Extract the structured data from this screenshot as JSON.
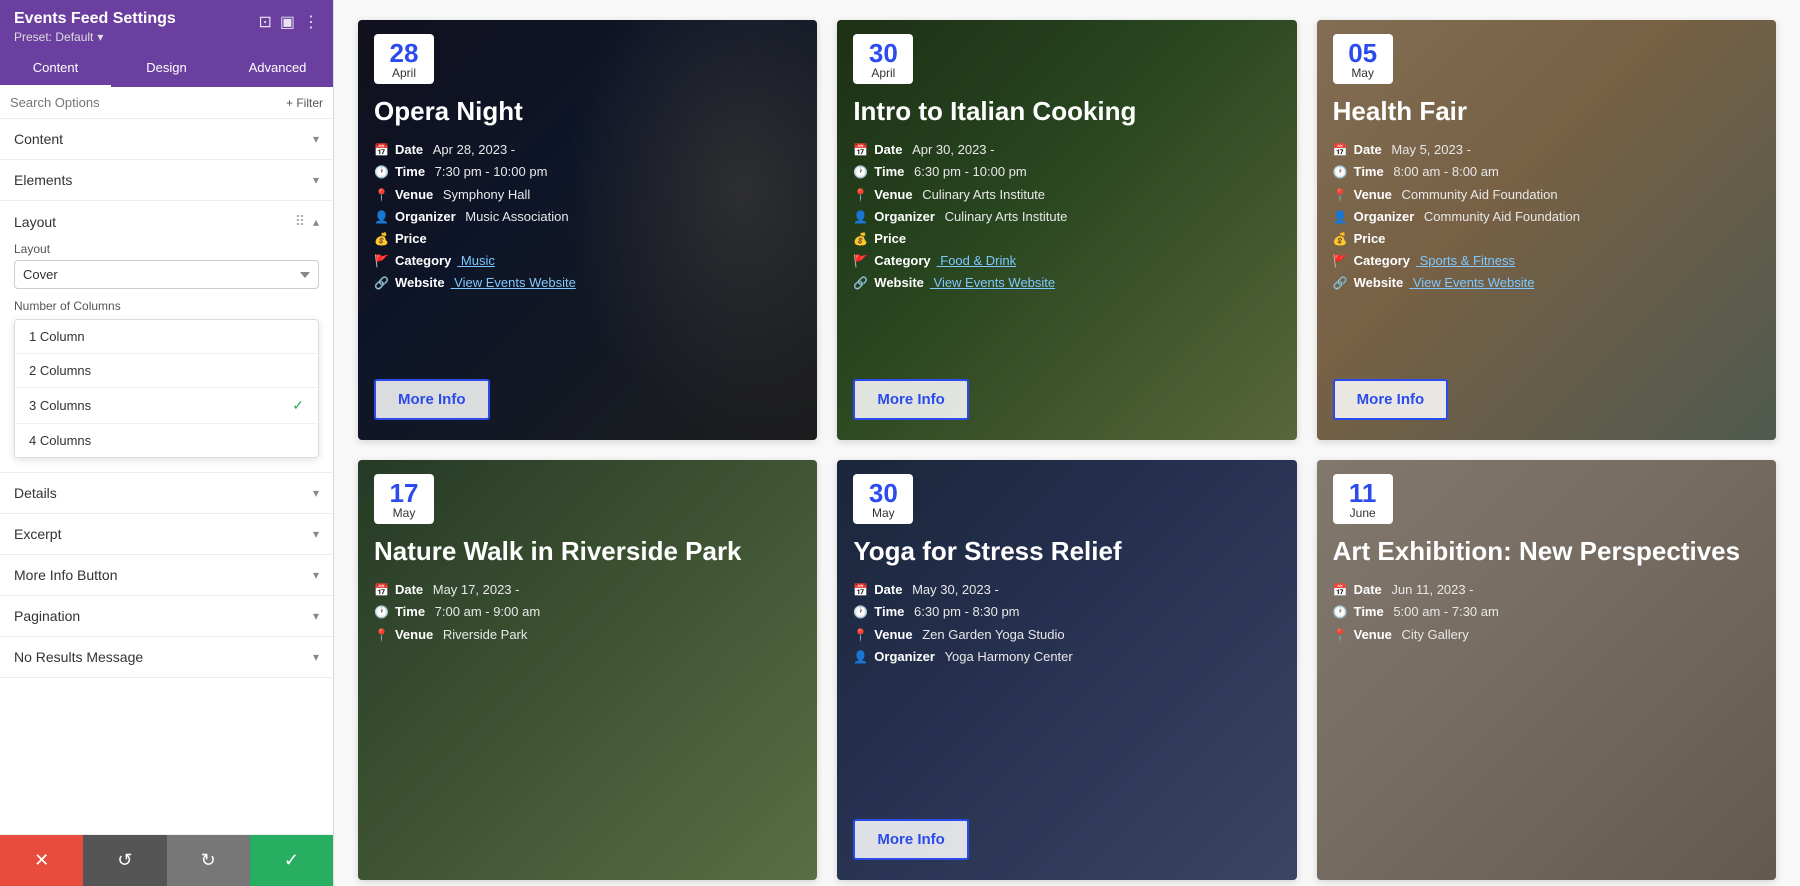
{
  "app": {
    "title": "Events Feed Settings",
    "preset": "Preset: Default"
  },
  "sidebar": {
    "tabs": [
      {
        "id": "content",
        "label": "Content"
      },
      {
        "id": "design",
        "label": "Design"
      },
      {
        "id": "advanced",
        "label": "Advanced"
      }
    ],
    "active_tab": "content",
    "search_placeholder": "Search Options",
    "filter_label": "+ Filter",
    "sections": [
      {
        "id": "content",
        "label": "Content",
        "expanded": false
      },
      {
        "id": "elements",
        "label": "Elements",
        "expanded": false
      },
      {
        "id": "layout",
        "label": "Layout",
        "expanded": true
      },
      {
        "id": "details",
        "label": "Details",
        "expanded": false
      },
      {
        "id": "excerpt",
        "label": "Excerpt",
        "expanded": false
      },
      {
        "id": "more-info-button",
        "label": "More Info Button",
        "expanded": false
      },
      {
        "id": "pagination",
        "label": "Pagination",
        "expanded": false
      },
      {
        "id": "no-results-message",
        "label": "No Results Message",
        "expanded": false
      }
    ],
    "layout": {
      "label": "Layout",
      "value": "Cover",
      "columns_label": "Number of Columns",
      "options": [
        {
          "id": "1col",
          "label": "1 Column",
          "selected": false
        },
        {
          "id": "2col",
          "label": "2 Columns",
          "selected": false
        },
        {
          "id": "3col",
          "label": "3 Columns",
          "selected": true
        },
        {
          "id": "4col",
          "label": "4 Columns",
          "selected": false
        }
      ]
    },
    "bottom_bar": {
      "cancel_icon": "✕",
      "reset_icon": "↺",
      "redo_icon": "↻",
      "save_icon": "✓"
    }
  },
  "events": [
    {
      "id": "opera-night",
      "date_day": "28",
      "date_month": "April",
      "title": "Opera Night",
      "details": [
        {
          "icon": "📅",
          "label": "Date",
          "value": "Apr 28, 2023 -",
          "type": "text"
        },
        {
          "icon": "🕐",
          "label": "Time",
          "value": "7:30 pm - 10:00 pm",
          "type": "text"
        },
        {
          "icon": "📍",
          "label": "Venue",
          "value": "Symphony Hall",
          "type": "text"
        },
        {
          "icon": "👤",
          "label": "Organizer",
          "value": "Music Association",
          "type": "text"
        },
        {
          "icon": "💰",
          "label": "Price",
          "value": "",
          "type": "text"
        },
        {
          "icon": "🚩",
          "label": "Category",
          "value": "Music",
          "type": "link"
        },
        {
          "icon": "🔗",
          "label": "Website",
          "value": "View Events Website",
          "type": "link"
        }
      ],
      "more_info": "More Info",
      "card_class": "card-opera"
    },
    {
      "id": "italian-cooking",
      "date_day": "30",
      "date_month": "April",
      "title": "Intro to Italian Cooking",
      "details": [
        {
          "icon": "📅",
          "label": "Date",
          "value": "Apr 30, 2023 -",
          "type": "text"
        },
        {
          "icon": "🕐",
          "label": "Time",
          "value": "6:30 pm - 10:00 pm",
          "type": "text"
        },
        {
          "icon": "📍",
          "label": "Venue",
          "value": "Culinary Arts Institute",
          "type": "text"
        },
        {
          "icon": "👤",
          "label": "Organizer",
          "value": "Culinary Arts Institute",
          "type": "text"
        },
        {
          "icon": "💰",
          "label": "Price",
          "value": "",
          "type": "text"
        },
        {
          "icon": "🚩",
          "label": "Category",
          "value": "Food & Drink",
          "type": "link"
        },
        {
          "icon": "🔗",
          "label": "Website",
          "value": "View Events Website",
          "type": "link"
        }
      ],
      "more_info": "More Info",
      "card_class": "card-italian"
    },
    {
      "id": "health-fair",
      "date_day": "05",
      "date_month": "May",
      "title": "Health Fair",
      "details": [
        {
          "icon": "📅",
          "label": "Date",
          "value": "May 5, 2023 -",
          "type": "text"
        },
        {
          "icon": "🕐",
          "label": "Time",
          "value": "8:00 am - 8:00 am",
          "type": "text"
        },
        {
          "icon": "📍",
          "label": "Venue",
          "value": "Community Aid Foundation",
          "type": "text"
        },
        {
          "icon": "👤",
          "label": "Organizer",
          "value": "Community Aid Foundation",
          "type": "text"
        },
        {
          "icon": "💰",
          "label": "Price",
          "value": "",
          "type": "text"
        },
        {
          "icon": "🚩",
          "label": "Category",
          "value": "Sports & Fitness",
          "type": "link"
        },
        {
          "icon": "🔗",
          "label": "Website",
          "value": "View Events Website",
          "type": "link"
        }
      ],
      "more_info": "More Info",
      "card_class": "card-health"
    },
    {
      "id": "nature-walk",
      "date_day": "17",
      "date_month": "May",
      "title": "Nature Walk in Riverside Park",
      "details": [
        {
          "icon": "📅",
          "label": "Date",
          "value": "May 17, 2023 -",
          "type": "text"
        },
        {
          "icon": "🕐",
          "label": "Time",
          "value": "7:00 am - 9:00 am",
          "type": "text"
        },
        {
          "icon": "📍",
          "label": "Venue",
          "value": "Riverside Park",
          "type": "text"
        }
      ],
      "more_info": "",
      "card_class": "card-nature"
    },
    {
      "id": "yoga-stress-relief",
      "date_day": "30",
      "date_month": "May",
      "title": "Yoga for Stress Relief",
      "details": [
        {
          "icon": "📅",
          "label": "Date",
          "value": "May 30, 2023 -",
          "type": "text"
        },
        {
          "icon": "🕐",
          "label": "Time",
          "value": "6:30 pm - 8:30 pm",
          "type": "text"
        },
        {
          "icon": "📍",
          "label": "Venue",
          "value": "Zen Garden Yoga Studio",
          "type": "text"
        },
        {
          "icon": "👤",
          "label": "Organizer",
          "value": "Yoga Harmony Center",
          "type": "text"
        }
      ],
      "more_info": "More Info",
      "card_class": "card-yoga"
    },
    {
      "id": "art-exhibition",
      "date_day": "11",
      "date_month": "June",
      "title": "Art Exhibition: New Perspectives",
      "details": [
        {
          "icon": "📅",
          "label": "Date",
          "value": "Jun 11, 2023 -",
          "type": "text"
        },
        {
          "icon": "🕐",
          "label": "Time",
          "value": "5:00 am - 7:30 am",
          "type": "text"
        },
        {
          "icon": "📍",
          "label": "Venue",
          "value": "City Gallery",
          "type": "text"
        }
      ],
      "more_info": "",
      "card_class": "card-art"
    }
  ]
}
